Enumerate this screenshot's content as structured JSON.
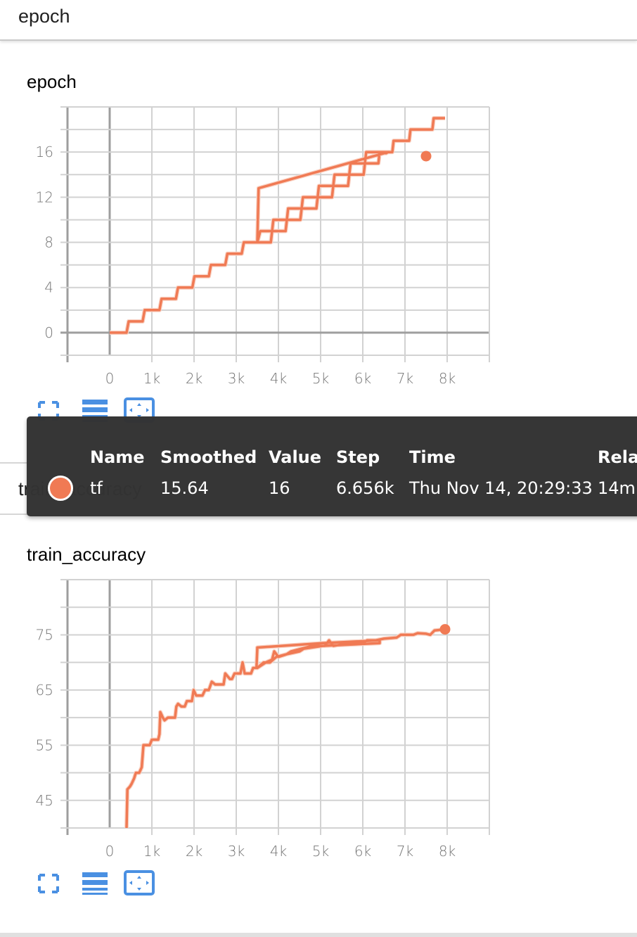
{
  "colors": {
    "series": "#f07a54",
    "series_faint": "#f9d2c4",
    "accent_blue": "#4a90e2",
    "tooltip_bg": "#333333"
  },
  "sections": [
    {
      "header": "epoch"
    },
    {
      "header": "train_accuracy"
    }
  ],
  "toolbar": {
    "fullscreen_icon": "fullscreen-icon",
    "data_toggle_icon": "list-icon",
    "fit_domain_icon": "fit-domain-icon"
  },
  "tooltip": {
    "headers": [
      "Name",
      "Smoothed",
      "Value",
      "Step",
      "Time",
      "Relative"
    ],
    "headers_visible": [
      "Name",
      "Smoothed",
      "Value",
      "Step",
      "Time",
      "Rela"
    ],
    "row": {
      "name": "tf",
      "smoothed": "15.64",
      "value": "16",
      "step": "6.656k",
      "time": "Thu Nov 14, 20:29:33",
      "relative": "14m"
    }
  },
  "chart_data": [
    {
      "type": "line",
      "title": "epoch",
      "xlabel": "",
      "ylabel": "",
      "xlim": [
        -1000,
        9000
      ],
      "ylim": [
        -2,
        20
      ],
      "x_ticks": [
        0,
        1000,
        2000,
        3000,
        4000,
        5000,
        6000,
        7000,
        8000
      ],
      "x_tick_labels": [
        "0",
        "1k",
        "2k",
        "3k",
        "4k",
        "5k",
        "6k",
        "7k",
        "8k"
      ],
      "y_ticks": [
        0,
        4,
        8,
        12,
        16
      ],
      "y_tick_labels": [
        "0",
        "4",
        "8",
        "12",
        "16"
      ],
      "grid": true,
      "series": [
        {
          "name": "tf",
          "points": [
            [
              0,
              0
            ],
            [
              400,
              0
            ],
            [
              450,
              1
            ],
            [
              780,
              1
            ],
            [
              830,
              2
            ],
            [
              1180,
              2
            ],
            [
              1230,
              3
            ],
            [
              1570,
              3
            ],
            [
              1620,
              4
            ],
            [
              1960,
              4
            ],
            [
              2010,
              5
            ],
            [
              2350,
              5
            ],
            [
              2400,
              6
            ],
            [
              2740,
              6
            ],
            [
              2790,
              7
            ],
            [
              3130,
              7
            ],
            [
              3180,
              8
            ],
            [
              3500,
              8
            ],
            [
              3530,
              12.8
            ],
            [
              6600,
              16
            ],
            [
              6550,
              15.9
            ],
            [
              6550,
              16
            ],
            [
              6400,
              16
            ],
            [
              6370,
              15
            ],
            [
              6050,
              15
            ],
            [
              6020,
              14
            ],
            [
              5680,
              14
            ],
            [
              5650,
              13
            ],
            [
              5300,
              13
            ],
            [
              5270,
              12
            ],
            [
              4930,
              12
            ],
            [
              4900,
              11
            ],
            [
              4550,
              11
            ],
            [
              4520,
              10
            ],
            [
              4200,
              10
            ],
            [
              4170,
              9
            ],
            [
              3850,
              9
            ],
            [
              3820,
              8
            ],
            [
              3500,
              8
            ],
            [
              3570,
              9
            ],
            [
              3850,
              9
            ],
            [
              3880,
              10
            ],
            [
              4200,
              10
            ],
            [
              4230,
              11
            ],
            [
              4550,
              11
            ],
            [
              4580,
              12
            ],
            [
              4930,
              12
            ],
            [
              4960,
              13
            ],
            [
              5300,
              13
            ],
            [
              5330,
              14
            ],
            [
              5680,
              14
            ],
            [
              5710,
              15
            ],
            [
              6050,
              15
            ],
            [
              6080,
              16
            ],
            [
              6700,
              16
            ],
            [
              6730,
              17
            ],
            [
              7100,
              17
            ],
            [
              7130,
              18
            ],
            [
              7650,
              18
            ],
            [
              7680,
              19
            ],
            [
              7950,
              19
            ]
          ]
        }
      ],
      "highlight_point": {
        "step": 7500,
        "value": 15.64
      },
      "tooltip_step": "6.656k"
    },
    {
      "type": "line",
      "title": "train_accuracy",
      "xlabel": "",
      "ylabel": "",
      "xlim": [
        -1000,
        9000
      ],
      "ylim": [
        40,
        85
      ],
      "x_ticks": [
        0,
        1000,
        2000,
        3000,
        4000,
        5000,
        6000,
        7000,
        8000
      ],
      "x_tick_labels": [
        "0",
        "1k",
        "2k",
        "3k",
        "4k",
        "5k",
        "6k",
        "7k",
        "8k"
      ],
      "y_ticks": [
        45,
        55,
        65,
        75
      ],
      "y_tick_labels": [
        "45",
        "55",
        "65",
        "75"
      ],
      "grid": true,
      "series": [
        {
          "name": "tf",
          "points": [
            [
              400,
              40
            ],
            [
              420,
              47
            ],
            [
              480,
              47.5
            ],
            [
              520,
              48
            ],
            [
              580,
              49
            ],
            [
              620,
              50
            ],
            [
              700,
              50
            ],
            [
              760,
              51
            ],
            [
              800,
              55
            ],
            [
              950,
              55
            ],
            [
              1000,
              56
            ],
            [
              1150,
              56
            ],
            [
              1180,
              57
            ],
            [
              1200,
              61
            ],
            [
              1260,
              60
            ],
            [
              1300,
              59.5
            ],
            [
              1380,
              60
            ],
            [
              1550,
              60
            ],
            [
              1580,
              62
            ],
            [
              1620,
              62.5
            ],
            [
              1700,
              62
            ],
            [
              1780,
              62
            ],
            [
              1830,
              63
            ],
            [
              1950,
              63
            ],
            [
              1990,
              65
            ],
            [
              2050,
              64
            ],
            [
              2200,
              64
            ],
            [
              2260,
              65
            ],
            [
              2350,
              65
            ],
            [
              2420,
              66.5
            ],
            [
              2500,
              66
            ],
            [
              2700,
              66
            ],
            [
              2740,
              68
            ],
            [
              2850,
              67
            ],
            [
              2900,
              67
            ],
            [
              2960,
              68
            ],
            [
              3100,
              68
            ],
            [
              3150,
              70
            ],
            [
              3200,
              68
            ],
            [
              3350,
              68
            ],
            [
              3400,
              69
            ],
            [
              3480,
              69
            ],
            [
              3500,
              72.7
            ],
            [
              5050,
              73.5
            ],
            [
              6400,
              74
            ],
            [
              6400,
              73.5
            ],
            [
              5050,
              73
            ],
            [
              4600,
              72.5
            ],
            [
              4500,
              72
            ],
            [
              4200,
              71.5
            ],
            [
              3950,
              71
            ],
            [
              3800,
              70
            ],
            [
              3650,
              70
            ],
            [
              3500,
              69
            ],
            [
              3700,
              70
            ],
            [
              3850,
              70.5
            ],
            [
              3900,
              72
            ],
            [
              4000,
              71
            ],
            [
              4200,
              71.5
            ],
            [
              4300,
              72
            ],
            [
              4550,
              72.5
            ],
            [
              4800,
              73
            ],
            [
              5100,
              73
            ],
            [
              5200,
              74
            ],
            [
              5300,
              73
            ],
            [
              5700,
              73.5
            ],
            [
              6000,
              73.5
            ],
            [
              6100,
              74
            ],
            [
              6300,
              74
            ],
            [
              6500,
              74.3
            ],
            [
              6800,
              74.5
            ],
            [
              6900,
              75
            ],
            [
              7200,
              75
            ],
            [
              7300,
              75.3
            ],
            [
              7500,
              75.2
            ],
            [
              7600,
              75
            ],
            [
              7700,
              75.8
            ],
            [
              7950,
              76
            ]
          ]
        }
      ],
      "highlight_point": {
        "step": 7950,
        "value": 76
      }
    }
  ]
}
